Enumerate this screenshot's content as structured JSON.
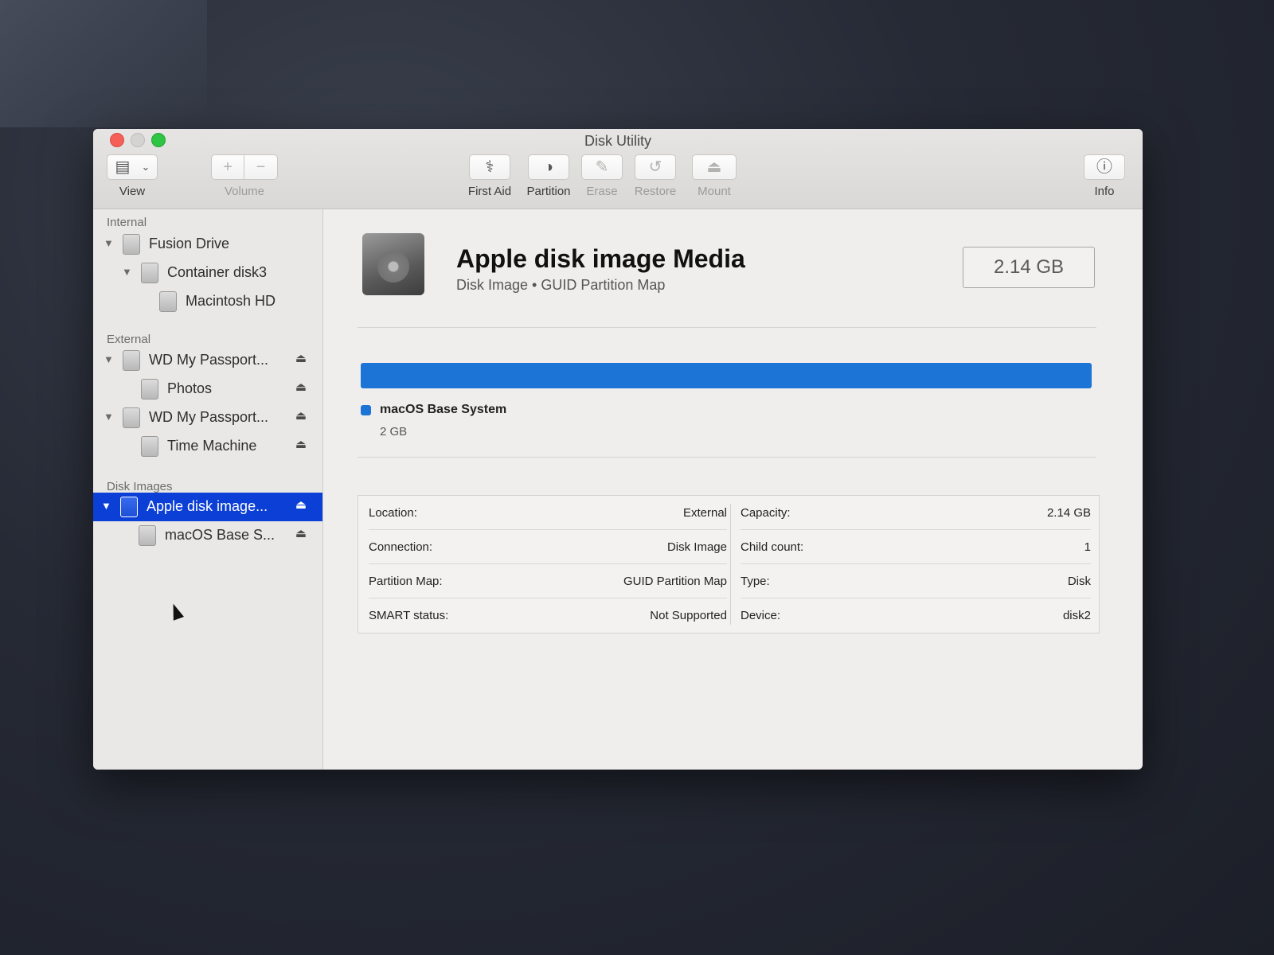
{
  "window": {
    "title": "Disk Utility"
  },
  "toolbar": {
    "view_label": "View",
    "volume_label": "Volume",
    "first_aid_label": "First Aid",
    "partition_label": "Partition",
    "erase_label": "Erase",
    "restore_label": "Restore",
    "mount_label": "Mount",
    "info_label": "Info"
  },
  "sidebar": {
    "sections": [
      {
        "header": "Internal"
      },
      {
        "header": "External"
      },
      {
        "header": "Disk Images"
      }
    ],
    "items": [
      {
        "label": "Fusion Drive",
        "section": "Internal",
        "expanded": true
      },
      {
        "label": "Container disk3",
        "section": "Internal",
        "expanded": true
      },
      {
        "label": "Macintosh HD",
        "section": "Internal"
      },
      {
        "label": "WD My Passport...",
        "section": "External",
        "expanded": true,
        "ejectable": true
      },
      {
        "label": "Photos",
        "section": "External",
        "ejectable": true
      },
      {
        "label": "WD My Passport...",
        "section": "External",
        "expanded": true,
        "ejectable": true
      },
      {
        "label": "Time Machine",
        "section": "External",
        "ejectable": true
      },
      {
        "label": "Apple disk image...",
        "section": "Disk Images",
        "expanded": true,
        "ejectable": true,
        "selected": true
      },
      {
        "label": "macOS Base S...",
        "section": "Disk Images",
        "ejectable": true
      }
    ]
  },
  "detail": {
    "title": "Apple disk image Media",
    "subtitle": "Disk Image • GUID Partition Map",
    "size": "2.14 GB",
    "usage_fraction": 1.0,
    "usage_color": "#1b74d6",
    "legend_name": "macOS Base System",
    "legend_size": "2 GB",
    "info_left": [
      {
        "key": "Location:",
        "value": "External"
      },
      {
        "key": "Connection:",
        "value": "Disk Image"
      },
      {
        "key": "Partition Map:",
        "value": "GUID Partition Map"
      },
      {
        "key": "SMART status:",
        "value": "Not Supported"
      }
    ],
    "info_right": [
      {
        "key": "Capacity:",
        "value": "2.14 GB"
      },
      {
        "key": "Child count:",
        "value": "1"
      },
      {
        "key": "Type:",
        "value": "Disk"
      },
      {
        "key": "Device:",
        "value": "disk2"
      }
    ]
  },
  "colors": {
    "selection": "#0b3fd6",
    "accent": "#1b74d6"
  }
}
